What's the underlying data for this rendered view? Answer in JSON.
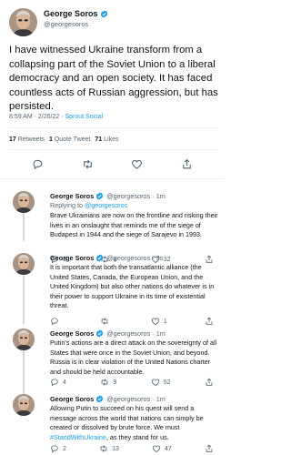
{
  "main_tweet": {
    "name": "George Soros",
    "handle": "@georgesoros",
    "text": "I have witnessed Ukraine transform from a collapsing part of the Soviet Union to a liberal democracy and an open society. It has faced countless acts of Russian aggression, but has persisted.",
    "meta_time": "8:59 AM · 2/26/22 · ",
    "meta_source": "Sprout Social",
    "retweets_count": "17",
    "retweets_label": "Retweets",
    "quotes_count": "1",
    "quotes_label": "Quote Tweet",
    "likes_count": "71",
    "likes_label": "Likes"
  },
  "replies": [
    {
      "name": "George Soros",
      "handle": "@georgesoros · 1m",
      "replying_prefix": "Replying to ",
      "replying_to": "@georgesoros",
      "text": "Brave Ukrainians are now on the frontline and risking their lives in an onslaught that reminds me of the siege of Budapest in 1944 and the siege of Sarajevo in 1993.",
      "replies": "3",
      "retweets": "8",
      "likes": "32"
    },
    {
      "name": "George Soros",
      "handle": "@georgesoros · 9s",
      "text": "It is important that both the transatlantic alliance (the United States, Canada, the European Union, and the United Kingdom) but also other nations do whatever is in their power to support Ukraine in its time of existential threat.",
      "replies": "",
      "retweets": "",
      "likes": "1"
    },
    {
      "name": "George Soros",
      "handle": "@georgesoros · 1m",
      "text": "Putin's actions are a direct attack on the sovereignty of all States that were once in the Soviet Union, and beyond. Russia is in clear violation of the United Nations charter and should be held accountable.",
      "replies": "4",
      "retweets": "9",
      "likes": "52"
    },
    {
      "name": "George Soros",
      "handle": "@georgesoros · 1m",
      "text": "Allowing Putin to succeed on his quest will send a message across the world that nations can simply be created or dissolved by brute force. We must ",
      "hashtag": "#StandWithUkraine",
      "text_end": ", as they stand for us.",
      "replies": "2",
      "retweets": "13",
      "likes": "47"
    }
  ],
  "colors": {
    "accent": "#1d9bf0",
    "secondary_text": "#536471",
    "primary_text": "#0f1419",
    "divider": "#eff3f4"
  },
  "icons": [
    "verified-badge-icon",
    "reply-icon",
    "retweet-icon",
    "like-icon",
    "share-icon"
  ]
}
